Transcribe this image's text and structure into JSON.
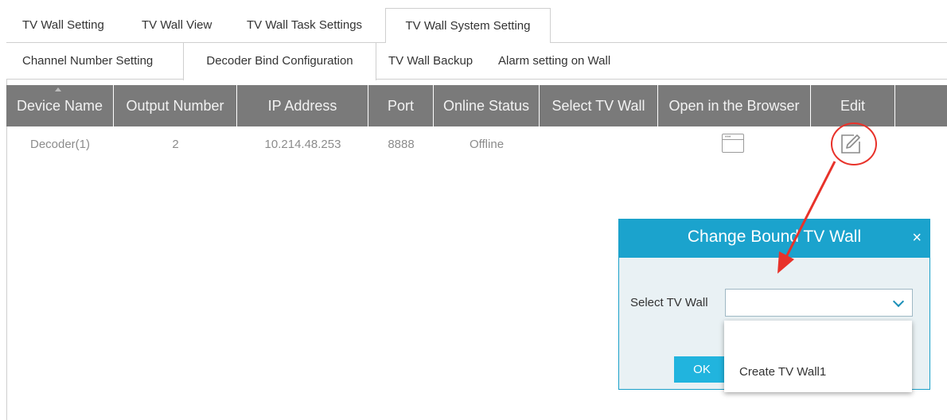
{
  "top_tabs": [
    {
      "label": "TV Wall Setting",
      "active": false
    },
    {
      "label": "TV Wall View",
      "active": false
    },
    {
      "label": "TV Wall Task Settings",
      "active": false
    },
    {
      "label": "TV Wall System Setting",
      "active": true
    }
  ],
  "sub_tabs": [
    {
      "label": "Channel Number Setting",
      "active": false
    },
    {
      "label": "Decoder Bind Configuration",
      "active": true
    },
    {
      "label": "TV Wall Backup",
      "active": false
    },
    {
      "label": "Alarm setting on Wall",
      "active": false
    }
  ],
  "table": {
    "columns": [
      "Device Name",
      "Output Number",
      "IP Address",
      "Port",
      "Online Status",
      "Select TV Wall",
      "Open in the Browser",
      "Edit"
    ],
    "rows": [
      {
        "device_name": "Decoder(1)",
        "output_number": "2",
        "ip_address": "10.214.48.253",
        "port": "8888",
        "online_status": "Offline",
        "select_tv_wall": ""
      }
    ]
  },
  "icons": {
    "browser": "browser-window-icon",
    "edit": "edit-pencil-icon",
    "close": "close-icon",
    "dropdown": "chevron-down-icon",
    "sort": "sort-ascending-icon"
  },
  "dialog": {
    "title": "Change Bound TV Wall",
    "close_glyph": "×",
    "select_label": "Select TV Wall",
    "select_value": "",
    "ok_label": "OK",
    "options": [
      "Create TV Wall1"
    ]
  },
  "annotation": {
    "color": "#e8322a"
  },
  "colors": {
    "header_bg": "#7a7a7a",
    "dialog_accent": "#1ba3cd",
    "ok_button": "#21b4de"
  }
}
